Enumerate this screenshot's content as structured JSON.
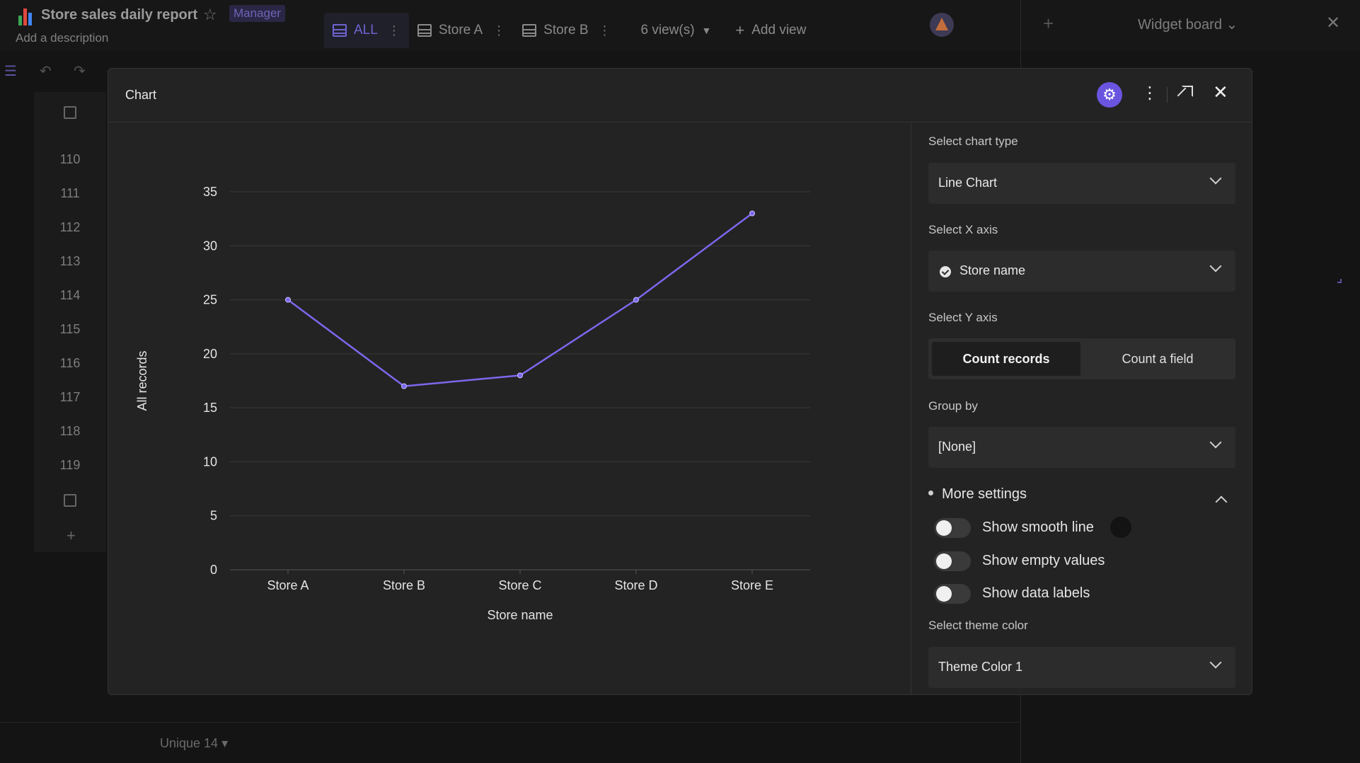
{
  "app": {
    "title": "Store sales daily report",
    "role": "Manager",
    "description": "Add a description"
  },
  "views": {
    "tabs": [
      {
        "label": "ALL",
        "active": true
      },
      {
        "label": "Store A",
        "active": false
      },
      {
        "label": "Store B",
        "active": false
      }
    ],
    "count_label": "6 view(s)",
    "add_label": "Add view"
  },
  "widget_board": {
    "title": "Widget board"
  },
  "grid": {
    "rows": [
      "110",
      "111",
      "112",
      "113",
      "114",
      "115",
      "116",
      "117",
      "118",
      "119"
    ],
    "footer": "Unique 14 ▾"
  },
  "modal": {
    "title": "Chart"
  },
  "settings": {
    "chart_type_label": "Select chart type",
    "chart_type_value": "Line Chart",
    "x_axis_label": "Select X axis",
    "x_axis_value": "Store name",
    "y_axis_label": "Select Y axis",
    "y_axis_options": [
      "Count records",
      "Count a field"
    ],
    "y_axis_selected": "Count records",
    "group_by_label": "Group by",
    "group_by_value": "[None]",
    "more_settings_label": "More settings",
    "toggles": [
      {
        "label": "Show smooth line",
        "on": false
      },
      {
        "label": "Show empty values",
        "on": false
      },
      {
        "label": "Show data labels",
        "on": false
      }
    ],
    "theme_label": "Select theme color",
    "theme_value": "Theme Color 1"
  },
  "colors": {
    "accent": "#6a55e0",
    "line": "#7b68ee"
  },
  "chart_data": {
    "type": "line",
    "categories": [
      "Store A",
      "Store B",
      "Store C",
      "Store D",
      "Store E"
    ],
    "values": [
      25,
      17,
      18,
      25,
      33
    ],
    "xlabel": "Store name",
    "ylabel": "All records",
    "ylim": [
      0,
      35
    ],
    "yticks": [
      0,
      5,
      10,
      15,
      20,
      25,
      30,
      35
    ],
    "grid": true
  }
}
